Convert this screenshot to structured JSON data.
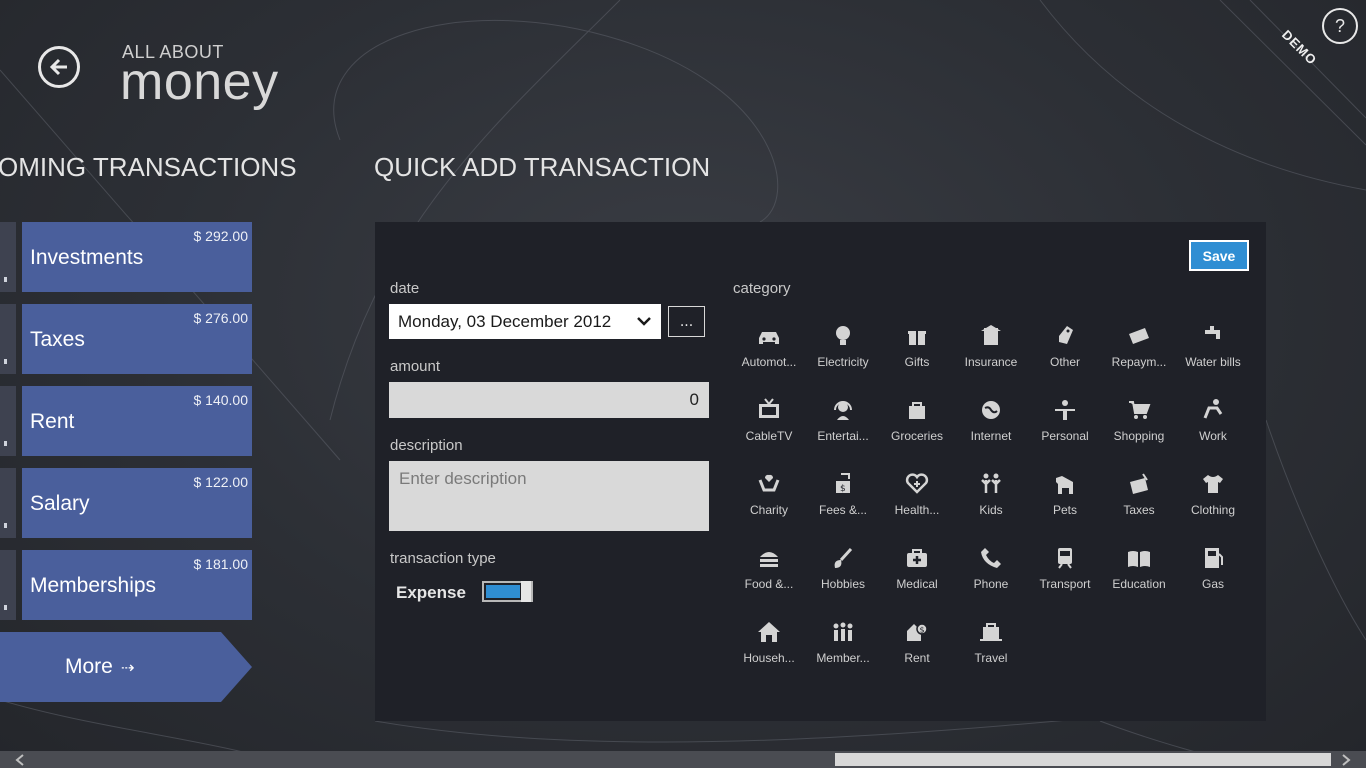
{
  "header": {
    "subtitle": "ALL ABOUT",
    "title": "money",
    "help_label": "?",
    "demo_badge": "DEMO"
  },
  "upcoming": {
    "heading": "OMING TRANSACTIONS",
    "items": [
      {
        "name": "Investments",
        "amount": "$ 292.00"
      },
      {
        "name": "Taxes",
        "amount": "$ 276.00"
      },
      {
        "name": "Rent",
        "amount": "$ 140.00"
      },
      {
        "name": "Salary",
        "amount": "$ 122.00"
      },
      {
        "name": "Memberships",
        "amount": "$ 181.00"
      }
    ],
    "more_label": "More",
    "more_arrow": "⇢"
  },
  "quick_add": {
    "heading": "QUICK ADD TRANSACTION",
    "save_label": "Save",
    "date_label": "date",
    "date_value": "Monday, 03 December 2012",
    "date_picker_label": "...",
    "amount_label": "amount",
    "amount_value": "0",
    "description_label": "description",
    "description_placeholder": "Enter description",
    "type_label": "transaction type",
    "type_value": "Expense",
    "category_label": "category",
    "categories": [
      {
        "label": "Automot...",
        "icon": "car-icon"
      },
      {
        "label": "Electricity",
        "icon": "bulb-icon"
      },
      {
        "label": "Gifts",
        "icon": "gift-icon"
      },
      {
        "label": "Insurance",
        "icon": "insurance-icon"
      },
      {
        "label": "Other",
        "icon": "tag-icon"
      },
      {
        "label": "Repaym...",
        "icon": "card-icon"
      },
      {
        "label": "Water bills",
        "icon": "faucet-icon"
      },
      {
        "label": "CableTV",
        "icon": "tv-icon"
      },
      {
        "label": "Entertai...",
        "icon": "headset-icon"
      },
      {
        "label": "Groceries",
        "icon": "bag-icon"
      },
      {
        "label": "Internet",
        "icon": "globe-icon"
      },
      {
        "label": "Personal",
        "icon": "person-icon"
      },
      {
        "label": "Shopping",
        "icon": "cart-icon"
      },
      {
        "label": "Work",
        "icon": "desk-icon"
      },
      {
        "label": "Charity",
        "icon": "hands-heart-icon"
      },
      {
        "label": "Fees &...",
        "icon": "fees-icon"
      },
      {
        "label": "Health...",
        "icon": "heart-plus-icon"
      },
      {
        "label": "Kids",
        "icon": "kids-icon"
      },
      {
        "label": "Pets",
        "icon": "dog-icon"
      },
      {
        "label": "Taxes",
        "icon": "money-icon"
      },
      {
        "label": "Clothing",
        "icon": "shirt-icon"
      },
      {
        "label": "Food &...",
        "icon": "burger-icon"
      },
      {
        "label": "Hobbies",
        "icon": "brush-icon"
      },
      {
        "label": "Medical",
        "icon": "medkit-icon"
      },
      {
        "label": "Phone",
        "icon": "phone-icon"
      },
      {
        "label": "Transport",
        "icon": "train-icon"
      },
      {
        "label": "Education",
        "icon": "book-icon"
      },
      {
        "label": "Gas",
        "icon": "fuel-icon"
      },
      {
        "label": "Househ...",
        "icon": "house-icon"
      },
      {
        "label": "Member...",
        "icon": "group-icon"
      },
      {
        "label": "Rent",
        "icon": "rent-icon"
      },
      {
        "label": "Travel",
        "icon": "luggage-icon"
      }
    ]
  },
  "colors": {
    "tile": "#4a5f9c",
    "panel": "#1f2128",
    "accent": "#2f8ed3"
  }
}
